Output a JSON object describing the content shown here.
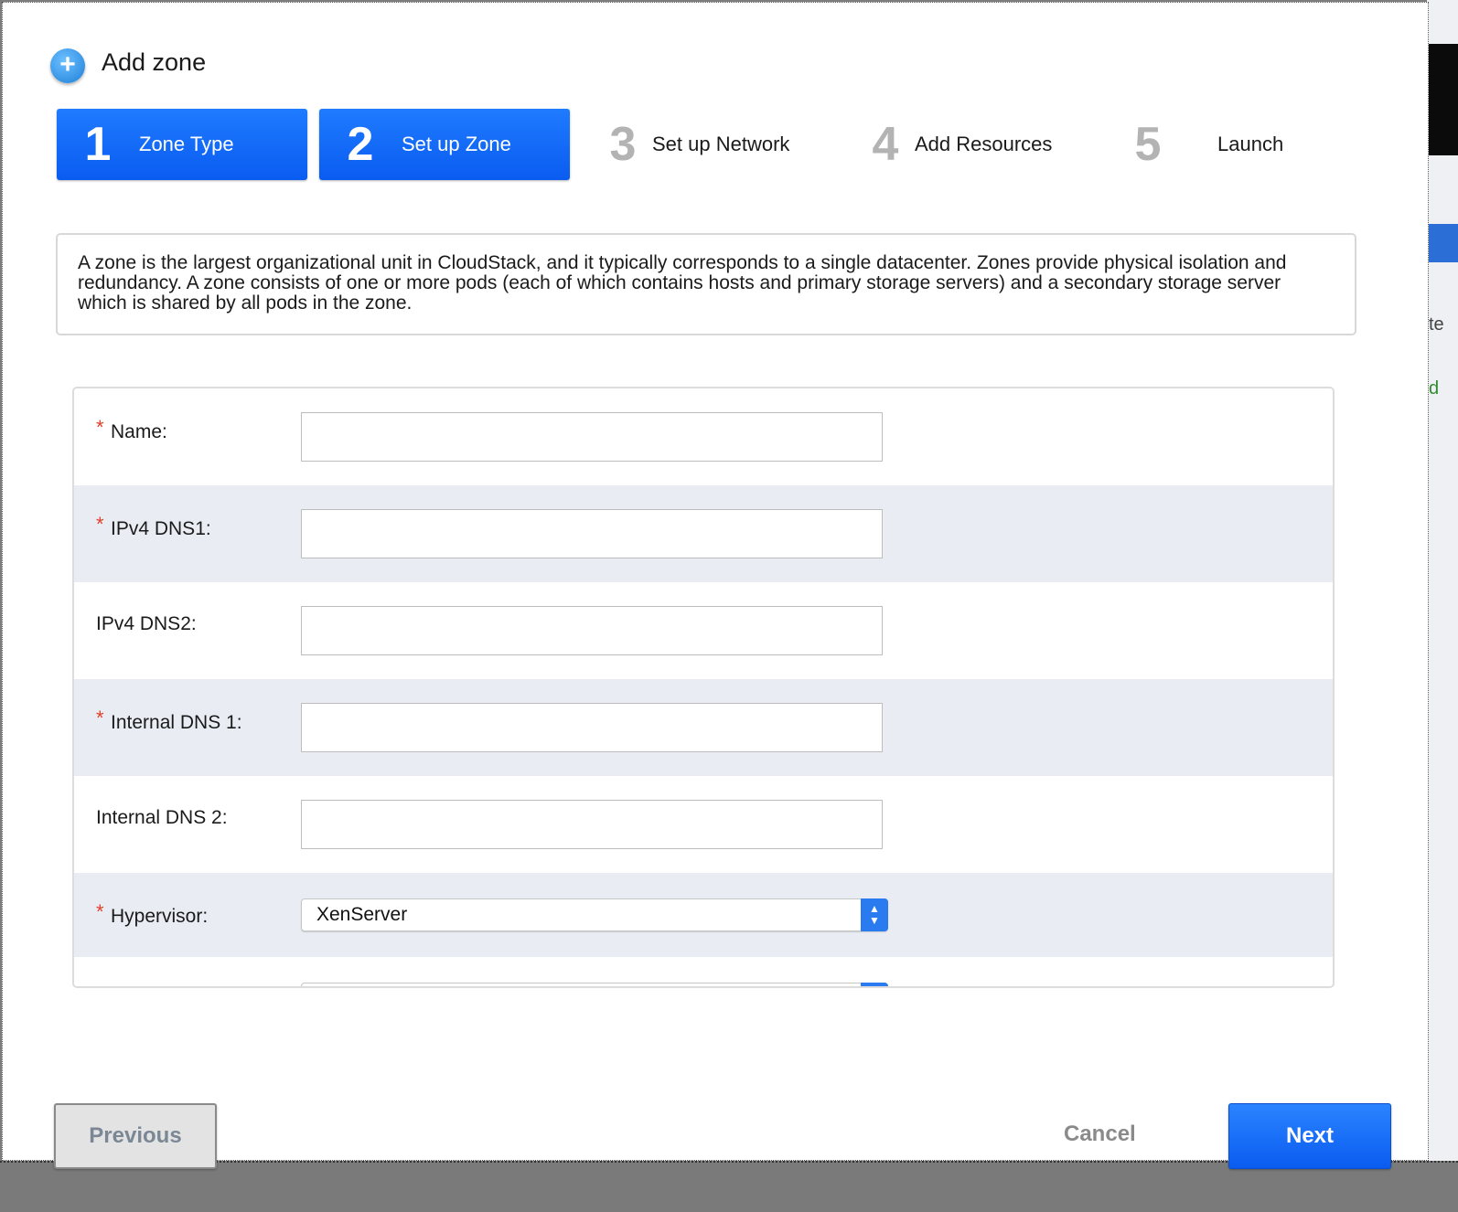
{
  "dialog": {
    "title": "Add zone",
    "steps": [
      {
        "num": "1",
        "label": "Zone Type",
        "state": "active"
      },
      {
        "num": "2",
        "label": "Set up Zone",
        "state": "active"
      },
      {
        "num": "3",
        "label": "Set up Network",
        "state": "inactive"
      },
      {
        "num": "4",
        "label": "Add Resources",
        "state": "inactive"
      },
      {
        "num": "5",
        "label": "Launch",
        "state": "inactive"
      }
    ],
    "description": "A zone is the largest organizational unit in CloudStack, and it typically corresponds to a single datacenter. Zones provide physical isolation and redundancy. A zone consists of one or more pods (each of which contains hosts and primary storage servers) and a secondary storage server which is shared by all pods in the zone.",
    "form": {
      "required_marker": "*",
      "name": {
        "label": "Name:",
        "value": ""
      },
      "ipv4_dns1": {
        "label": "IPv4 DNS1:",
        "value": ""
      },
      "ipv4_dns2": {
        "label": "IPv4 DNS2:",
        "value": ""
      },
      "internal_dns1": {
        "label": "Internal DNS 1:",
        "value": ""
      },
      "internal_dns2": {
        "label": "Internal DNS 2:",
        "value": ""
      },
      "hypervisor": {
        "label": "Hypervisor:",
        "value": "XenServer"
      }
    },
    "buttons": {
      "previous": "Previous",
      "cancel": "Cancel",
      "next": "Next"
    }
  },
  "background": {
    "partial_text_1": "te",
    "partial_text_2": "d"
  },
  "colors": {
    "accent": "#0a5cf0",
    "required": "#e0402a",
    "row_alt": "#e9edf3"
  }
}
